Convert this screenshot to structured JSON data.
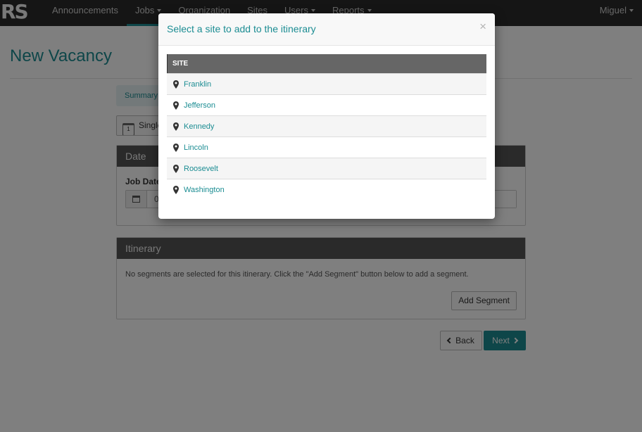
{
  "brand": "RS",
  "nav": {
    "items": [
      {
        "label": "Announcements",
        "dropdown": false
      },
      {
        "label": "Jobs",
        "dropdown": true
      },
      {
        "label": "Organization",
        "dropdown": false
      },
      {
        "label": "Sites",
        "dropdown": false
      },
      {
        "label": "Users",
        "dropdown": true
      },
      {
        "label": "Reports",
        "dropdown": true
      }
    ],
    "user": "Miguel"
  },
  "page": {
    "title": "New Vacancy",
    "wizard_tab": "Summary",
    "type_button": "Single"
  },
  "date_panel": {
    "heading": "Date",
    "job_date_label": "Job Date",
    "job_date_value": "0"
  },
  "itinerary_panel": {
    "heading": "Itinerary",
    "message": "No segments are selected for this itinerary. Click the \"Add Segment\" button below to add a segment.",
    "add_segment": "Add Segment"
  },
  "actions": {
    "back": "Back",
    "next": "Next"
  },
  "modal": {
    "title": "Select a site to add to the itinerary",
    "close": "×",
    "column_header": "SITE",
    "sites": [
      "Franklin",
      "Jefferson",
      "Kennedy",
      "Lincoln",
      "Roosevelt",
      "Washington"
    ]
  },
  "colors": {
    "accent": "#1c8d93",
    "navbar": "#2b2b2b",
    "panel_header": "#555555"
  }
}
